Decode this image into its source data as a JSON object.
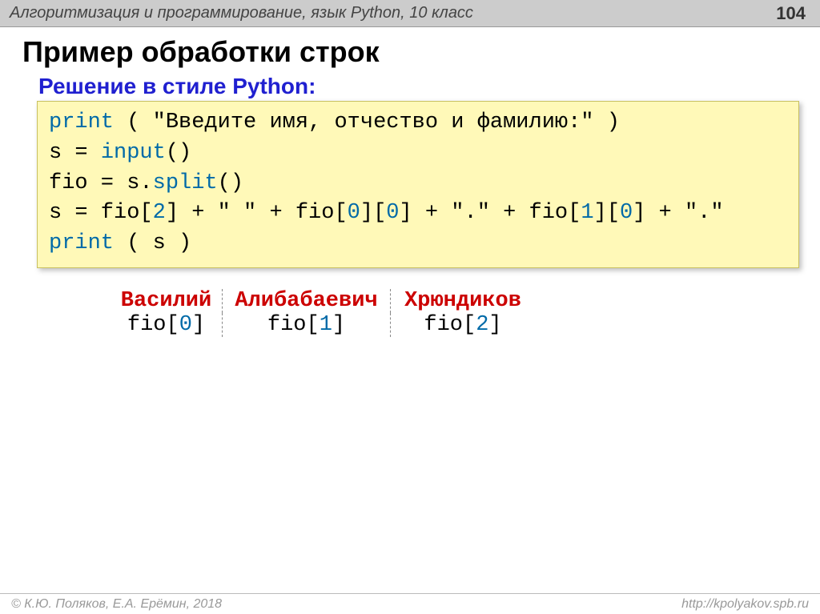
{
  "header": {
    "course": "Алгоритмизация и программирование, язык Python, 10 класс",
    "page": "104"
  },
  "title": "Пример обработки строк",
  "subtitle": "Решение в стиле Python:",
  "code": {
    "l1_kw": "print",
    "l1_rest": " ( \"Введите имя, отчество и фамилию:\" )",
    "l2_a": "s = ",
    "l2_kw": "input",
    "l2_b": "()",
    "l3_a": "fio = s.",
    "l3_kw": "split",
    "l3_b": "()",
    "l4_a": "s = fio[",
    "l4_n1": "2",
    "l4_b": "] + \" \" + fio[",
    "l4_n2": "0",
    "l4_c": "][",
    "l4_n3": "0",
    "l4_d": "] + \".\" + fio[",
    "l4_n4": "1",
    "l4_e": "][",
    "l4_n5": "0",
    "l4_f": "] + \".\"",
    "l5_kw": "print",
    "l5_rest": " ( s )"
  },
  "example": {
    "names": [
      "Василий",
      "Алибабаевич",
      "Хрюндиков"
    ],
    "labels_plain": [
      "fio[",
      "fio[",
      "fio["
    ],
    "labels_num": [
      "0",
      "1",
      "2"
    ],
    "labels_close": [
      "]",
      "]",
      "]"
    ]
  },
  "footer": {
    "left": "© К.Ю. Поляков, Е.А. Ерёмин, 2018",
    "right": "http://kpolyakov.spb.ru"
  }
}
